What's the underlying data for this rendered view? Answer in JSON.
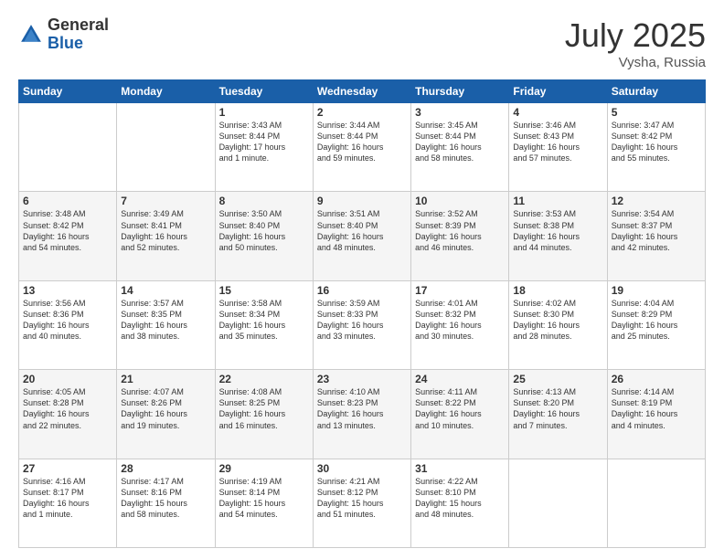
{
  "logo": {
    "general": "General",
    "blue": "Blue"
  },
  "title": {
    "month": "July 2025",
    "location": "Vysha, Russia"
  },
  "days_of_week": [
    "Sunday",
    "Monday",
    "Tuesday",
    "Wednesday",
    "Thursday",
    "Friday",
    "Saturday"
  ],
  "weeks": [
    [
      {
        "day": "",
        "info": ""
      },
      {
        "day": "",
        "info": ""
      },
      {
        "day": "1",
        "info": "Sunrise: 3:43 AM\nSunset: 8:44 PM\nDaylight: 17 hours\nand 1 minute."
      },
      {
        "day": "2",
        "info": "Sunrise: 3:44 AM\nSunset: 8:44 PM\nDaylight: 16 hours\nand 59 minutes."
      },
      {
        "day": "3",
        "info": "Sunrise: 3:45 AM\nSunset: 8:44 PM\nDaylight: 16 hours\nand 58 minutes."
      },
      {
        "day": "4",
        "info": "Sunrise: 3:46 AM\nSunset: 8:43 PM\nDaylight: 16 hours\nand 57 minutes."
      },
      {
        "day": "5",
        "info": "Sunrise: 3:47 AM\nSunset: 8:42 PM\nDaylight: 16 hours\nand 55 minutes."
      }
    ],
    [
      {
        "day": "6",
        "info": "Sunrise: 3:48 AM\nSunset: 8:42 PM\nDaylight: 16 hours\nand 54 minutes."
      },
      {
        "day": "7",
        "info": "Sunrise: 3:49 AM\nSunset: 8:41 PM\nDaylight: 16 hours\nand 52 minutes."
      },
      {
        "day": "8",
        "info": "Sunrise: 3:50 AM\nSunset: 8:40 PM\nDaylight: 16 hours\nand 50 minutes."
      },
      {
        "day": "9",
        "info": "Sunrise: 3:51 AM\nSunset: 8:40 PM\nDaylight: 16 hours\nand 48 minutes."
      },
      {
        "day": "10",
        "info": "Sunrise: 3:52 AM\nSunset: 8:39 PM\nDaylight: 16 hours\nand 46 minutes."
      },
      {
        "day": "11",
        "info": "Sunrise: 3:53 AM\nSunset: 8:38 PM\nDaylight: 16 hours\nand 44 minutes."
      },
      {
        "day": "12",
        "info": "Sunrise: 3:54 AM\nSunset: 8:37 PM\nDaylight: 16 hours\nand 42 minutes."
      }
    ],
    [
      {
        "day": "13",
        "info": "Sunrise: 3:56 AM\nSunset: 8:36 PM\nDaylight: 16 hours\nand 40 minutes."
      },
      {
        "day": "14",
        "info": "Sunrise: 3:57 AM\nSunset: 8:35 PM\nDaylight: 16 hours\nand 38 minutes."
      },
      {
        "day": "15",
        "info": "Sunrise: 3:58 AM\nSunset: 8:34 PM\nDaylight: 16 hours\nand 35 minutes."
      },
      {
        "day": "16",
        "info": "Sunrise: 3:59 AM\nSunset: 8:33 PM\nDaylight: 16 hours\nand 33 minutes."
      },
      {
        "day": "17",
        "info": "Sunrise: 4:01 AM\nSunset: 8:32 PM\nDaylight: 16 hours\nand 30 minutes."
      },
      {
        "day": "18",
        "info": "Sunrise: 4:02 AM\nSunset: 8:30 PM\nDaylight: 16 hours\nand 28 minutes."
      },
      {
        "day": "19",
        "info": "Sunrise: 4:04 AM\nSunset: 8:29 PM\nDaylight: 16 hours\nand 25 minutes."
      }
    ],
    [
      {
        "day": "20",
        "info": "Sunrise: 4:05 AM\nSunset: 8:28 PM\nDaylight: 16 hours\nand 22 minutes."
      },
      {
        "day": "21",
        "info": "Sunrise: 4:07 AM\nSunset: 8:26 PM\nDaylight: 16 hours\nand 19 minutes."
      },
      {
        "day": "22",
        "info": "Sunrise: 4:08 AM\nSunset: 8:25 PM\nDaylight: 16 hours\nand 16 minutes."
      },
      {
        "day": "23",
        "info": "Sunrise: 4:10 AM\nSunset: 8:23 PM\nDaylight: 16 hours\nand 13 minutes."
      },
      {
        "day": "24",
        "info": "Sunrise: 4:11 AM\nSunset: 8:22 PM\nDaylight: 16 hours\nand 10 minutes."
      },
      {
        "day": "25",
        "info": "Sunrise: 4:13 AM\nSunset: 8:20 PM\nDaylight: 16 hours\nand 7 minutes."
      },
      {
        "day": "26",
        "info": "Sunrise: 4:14 AM\nSunset: 8:19 PM\nDaylight: 16 hours\nand 4 minutes."
      }
    ],
    [
      {
        "day": "27",
        "info": "Sunrise: 4:16 AM\nSunset: 8:17 PM\nDaylight: 16 hours\nand 1 minute."
      },
      {
        "day": "28",
        "info": "Sunrise: 4:17 AM\nSunset: 8:16 PM\nDaylight: 15 hours\nand 58 minutes."
      },
      {
        "day": "29",
        "info": "Sunrise: 4:19 AM\nSunset: 8:14 PM\nDaylight: 15 hours\nand 54 minutes."
      },
      {
        "day": "30",
        "info": "Sunrise: 4:21 AM\nSunset: 8:12 PM\nDaylight: 15 hours\nand 51 minutes."
      },
      {
        "day": "31",
        "info": "Sunrise: 4:22 AM\nSunset: 8:10 PM\nDaylight: 15 hours\nand 48 minutes."
      },
      {
        "day": "",
        "info": ""
      },
      {
        "day": "",
        "info": ""
      }
    ]
  ]
}
